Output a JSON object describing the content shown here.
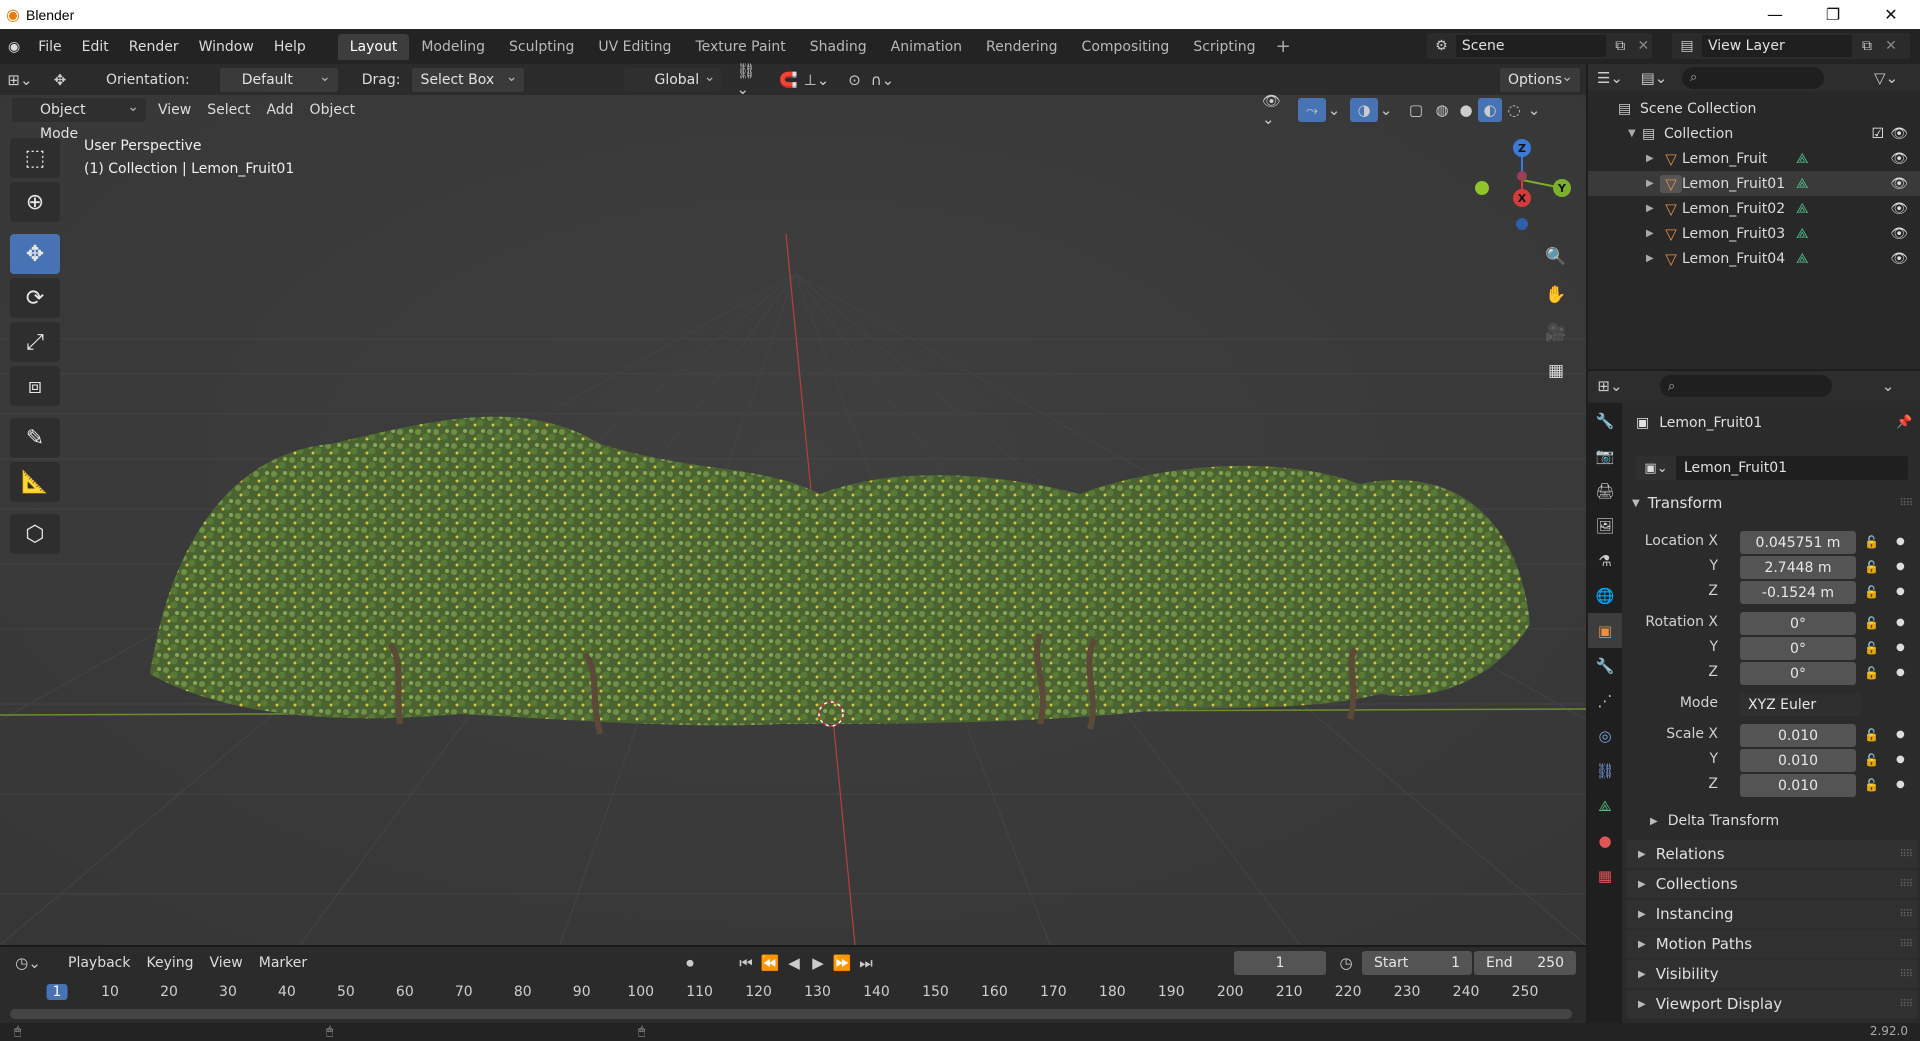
{
  "window": {
    "app_title": "Blender",
    "minimize": "—",
    "restore": "❐",
    "close": "✕"
  },
  "menu": [
    "File",
    "Edit",
    "Render",
    "Window",
    "Help"
  ],
  "workspaces": [
    "Layout",
    "Modeling",
    "Sculpting",
    "UV Editing",
    "Texture Paint",
    "Shading",
    "Animation",
    "Rendering",
    "Compositing",
    "Scripting"
  ],
  "active_workspace": "Layout",
  "scene": {
    "name": "Scene",
    "view_layer": "View Layer"
  },
  "viewport_header": {
    "orientation_label": "Orientation:",
    "orientation_value": "Default",
    "drag_label": "Drag:",
    "drag_value": "Select Box",
    "transform_orientation": "Global",
    "options": "Options",
    "mode": "Object Mode",
    "menus": [
      "View",
      "Select",
      "Add",
      "Object"
    ]
  },
  "viewport": {
    "perspective": "User Perspective",
    "collection_info": "(1) Collection | Lemon_Fruit01",
    "gizmo": {
      "x": "X",
      "y": "Y",
      "z": "Z"
    }
  },
  "outliner": {
    "scene_collection": "Scene Collection",
    "collection": "Collection",
    "objects": [
      "Lemon_Fruit",
      "Lemon_Fruit01",
      "Lemon_Fruit02",
      "Lemon_Fruit03",
      "Lemon_Fruit04"
    ]
  },
  "properties": {
    "object_name": "Lemon_Fruit01",
    "object_field": "Lemon_Fruit01",
    "transform_title": "Transform",
    "location_label": "Location X",
    "location": {
      "x": "0.045751 m",
      "y": "2.7448 m",
      "z": "-0.1524 m"
    },
    "rotation_label": "Rotation X",
    "rotation": {
      "x": "0°",
      "y": "0°",
      "z": "0°"
    },
    "mode_label": "Mode",
    "mode_value": "XYZ Euler",
    "scale_label": "Scale X",
    "scale": {
      "x": "0.010",
      "y": "0.010",
      "z": "0.010"
    },
    "axis_y": "Y",
    "axis_z": "Z",
    "delta_transform": "Delta Transform",
    "panels": [
      "Relations",
      "Collections",
      "Instancing",
      "Motion Paths",
      "Visibility",
      "Viewport Display"
    ]
  },
  "timeline": {
    "menus": [
      "Playback",
      "Keying",
      "View",
      "Marker"
    ],
    "current_frame": "1",
    "start_label": "Start",
    "start_value": "1",
    "end_label": "End",
    "end_value": "250",
    "ruler": [
      "1",
      "10",
      "20",
      "30",
      "40",
      "50",
      "60",
      "70",
      "80",
      "90",
      "100",
      "110",
      "120",
      "130",
      "140",
      "150",
      "160",
      "170",
      "180",
      "190",
      "200",
      "210",
      "220",
      "230",
      "240",
      "250"
    ]
  },
  "status": {
    "version": "2.92.0"
  }
}
